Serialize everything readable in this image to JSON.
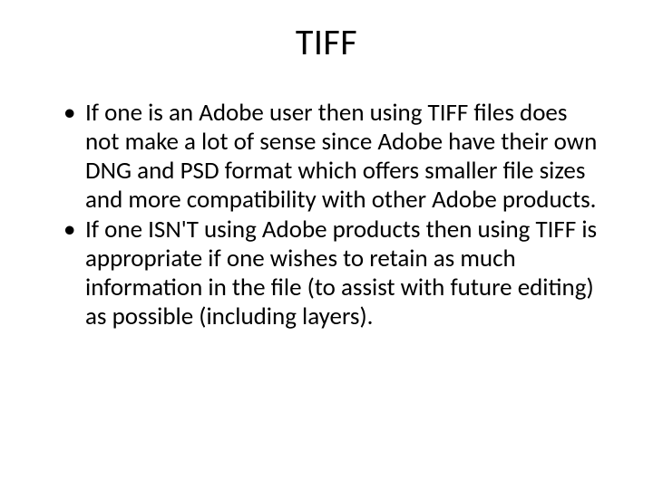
{
  "slide": {
    "title": "TIFF",
    "bullets": [
      "If one is an Adobe user then using TIFF files does not make a lot of sense since Adobe have their own DNG and PSD format which offers smaller file sizes and more compatibility with other Adobe products.",
      " If one ISN'T using Adobe products then using TIFF is appropriate if one wishes to retain as much information in the file (to assist with future editing) as possible (including layers)."
    ]
  }
}
